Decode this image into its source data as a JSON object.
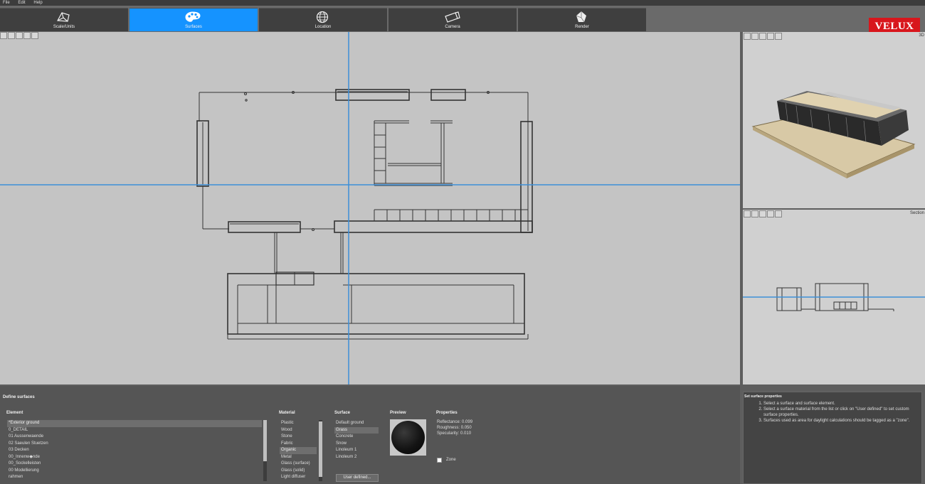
{
  "menu": [
    "File",
    "Edit",
    "Help"
  ],
  "tabs": [
    {
      "label": "Scale/Units",
      "icon": "scale-units-icon",
      "active": false
    },
    {
      "label": "Surfaces",
      "icon": "surfaces-palette-icon",
      "active": true
    },
    {
      "label": "Location",
      "icon": "globe-icon",
      "active": false
    },
    {
      "label": "Camera",
      "icon": "camera-icon",
      "active": false
    },
    {
      "label": "Render",
      "icon": "render-icon",
      "active": false
    }
  ],
  "logo": "VELUX",
  "views": {
    "perspective_label": "3D",
    "section_label": "Section"
  },
  "bottom": {
    "title": "Define surfaces",
    "element_header": "Element",
    "elements": [
      "*Exterior ground",
      "0_DETAIL",
      "01 Aussenwaende",
      "02 Saeulen Stuetzen",
      "03 Decken",
      "00_Innenw◆nde",
      "00_Sockelleisten",
      "00 Modellierung",
      "rahmen"
    ],
    "element_selected": 0,
    "material_header": "Material",
    "materials": [
      "Plastic",
      "Wood",
      "Stone",
      "Fabric",
      "Organic",
      "Metal",
      "Glass (surface)",
      "Glass (solid)",
      "Light diffuser"
    ],
    "material_selected": 4,
    "surface_header": "Surface",
    "surfaces": [
      "Default ground",
      "Grass",
      "Concrete",
      "Snow",
      "Linoleum 1",
      "Linoleum 2"
    ],
    "surface_selected": 1,
    "user_defined_label": "User defined...",
    "preview_header": "Preview",
    "properties_header": "Properties",
    "properties": [
      "Reflectance: 0.099",
      "Roughness: 0.050",
      "Specularity: 0.010"
    ],
    "zone_label": "Zone"
  },
  "help": {
    "title": "Set surface properties",
    "steps": [
      "Select a surface and surface element.",
      "Select a surface material from the list or click on \"User defined\" to set custom surface properties.",
      "Surfaces used as area for daylight calculations should be tagged as a \"zone\"."
    ]
  },
  "colors": {
    "accent": "#1593ff",
    "logo_red": "#d8161c",
    "guide_line": "#3d8fd8"
  }
}
